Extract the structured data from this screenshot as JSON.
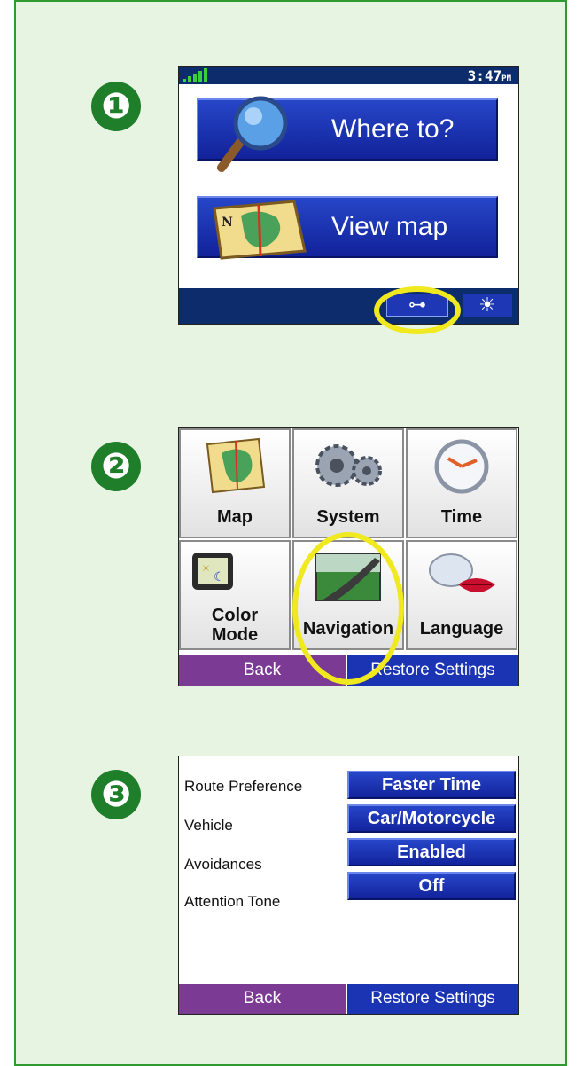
{
  "steps": [
    "❶",
    "❷",
    "❸"
  ],
  "screen1": {
    "clock": "3:47",
    "clock_suffix": "PM",
    "where_to": "Where to?",
    "view_map": "View map",
    "tools_icon": "wrench-icon",
    "brightness_icon": "sun-icon"
  },
  "screen2": {
    "tiles": [
      {
        "label": "Map",
        "icon": "map-icon"
      },
      {
        "label": "System",
        "icon": "gears-icon"
      },
      {
        "label": "Time",
        "icon": "clock-icon"
      },
      {
        "label": "Color\nMode",
        "icon": "color-mode-icon"
      },
      {
        "label": "Navigation",
        "icon": "road-icon"
      },
      {
        "label": "Language",
        "icon": "speech-lips-icon"
      }
    ],
    "back": "Back",
    "restore": "Restore Settings"
  },
  "screen3": {
    "settings": [
      {
        "label": "Route Preference",
        "value": "Faster Time"
      },
      {
        "label": "Vehicle",
        "value": "Car/Motorcycle"
      },
      {
        "label": "Avoidances",
        "value": "Enabled"
      },
      {
        "label": "Attention Tone",
        "value": "Off"
      }
    ],
    "back": "Back",
    "restore": "Restore Settings"
  },
  "colors": {
    "panel_bg": "#e6f4e1",
    "panel_border": "#2f9a30",
    "step_badge": "#1e7e2a",
    "button_blue": "#1a34b4",
    "back_purple": "#7b3a93",
    "status_bar": "#0c2c6b",
    "highlight_ring": "#f0e91f"
  }
}
